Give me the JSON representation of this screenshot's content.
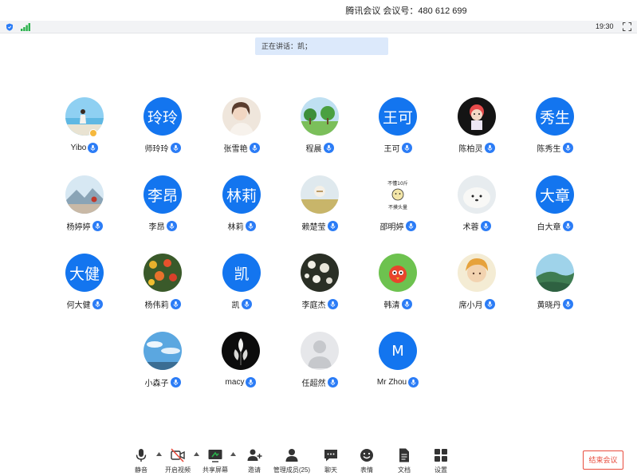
{
  "window": {
    "title": "腾讯会议  会议号：480 612 699"
  },
  "status": {
    "time": "19:30"
  },
  "speaker": {
    "label": "正在讲话：",
    "name": "凯；"
  },
  "participants": [
    {
      "name": "Yibo",
      "avatar_type": "photo",
      "avatar_theme": "beach",
      "initials": "",
      "host": true
    },
    {
      "name": "师玲玲",
      "avatar_type": "initials",
      "avatar_theme": "",
      "initials": "玲玲",
      "host": false
    },
    {
      "name": "张雪艳",
      "avatar_type": "photo",
      "avatar_theme": "portrait-girl",
      "initials": "",
      "host": false
    },
    {
      "name": "程晨",
      "avatar_type": "photo",
      "avatar_theme": "trees",
      "initials": "",
      "host": false
    },
    {
      "name": "王可",
      "avatar_type": "initials",
      "avatar_theme": "",
      "initials": "王可",
      "host": false
    },
    {
      "name": "陈柏灵",
      "avatar_type": "photo",
      "avatar_theme": "cartoon-girl",
      "initials": "",
      "host": false
    },
    {
      "name": "陈秀生",
      "avatar_type": "initials",
      "avatar_theme": "",
      "initials": "秀生",
      "host": false
    },
    {
      "name": "杨婷婷",
      "avatar_type": "photo",
      "avatar_theme": "mountain",
      "initials": "",
      "host": false
    },
    {
      "name": "李昂",
      "avatar_type": "initials",
      "avatar_theme": "",
      "initials": "李昂",
      "host": false
    },
    {
      "name": "林莉",
      "avatar_type": "initials",
      "avatar_theme": "",
      "initials": "林莉",
      "host": false
    },
    {
      "name": "赖楚莹",
      "avatar_type": "photo",
      "avatar_theme": "field",
      "initials": "",
      "host": false
    },
    {
      "name": "邵明婷",
      "avatar_type": "photo",
      "avatar_theme": "meme",
      "initials": "",
      "host": false,
      "avatar_text": [
        "不懂10斤",
        "不摸头量"
      ]
    },
    {
      "name": "术蓉",
      "avatar_type": "photo",
      "avatar_theme": "seal",
      "initials": "",
      "host": false
    },
    {
      "name": "白大章",
      "avatar_type": "initials",
      "avatar_theme": "",
      "initials": "大章",
      "host": false
    },
    {
      "name": "何大健",
      "avatar_type": "initials",
      "avatar_theme": "",
      "initials": "大健",
      "host": false
    },
    {
      "name": "杨伟莉",
      "avatar_type": "photo",
      "avatar_theme": "flowers",
      "initials": "",
      "host": false
    },
    {
      "name": "凯",
      "avatar_type": "initials",
      "avatar_theme": "",
      "initials": "凯",
      "host": false
    },
    {
      "name": "李庭杰",
      "avatar_type": "photo",
      "avatar_theme": "blossoms",
      "initials": "",
      "host": false
    },
    {
      "name": "韩清",
      "avatar_type": "photo",
      "avatar_theme": "cartoon-bird",
      "initials": "",
      "host": false
    },
    {
      "name": "席小月",
      "avatar_type": "photo",
      "avatar_theme": "anime",
      "initials": "",
      "host": false
    },
    {
      "name": "黄晓丹",
      "avatar_type": "photo",
      "avatar_theme": "hill",
      "initials": "",
      "host": false
    },
    {
      "name": "小森子",
      "avatar_type": "photo",
      "avatar_theme": "sky",
      "initials": "",
      "host": false
    },
    {
      "name": "macy",
      "avatar_type": "photo",
      "avatar_theme": "dark-flower",
      "initials": "",
      "host": false
    },
    {
      "name": "任超然",
      "avatar_type": "photo",
      "avatar_theme": "default-person",
      "initials": "",
      "host": false
    },
    {
      "name": "Mr Zhou",
      "avatar_type": "initials",
      "avatar_theme": "",
      "initials": "M",
      "host": false
    }
  ],
  "toolbar": {
    "mute": "静音",
    "video": "开启视频",
    "share": "共享屏幕",
    "invite": "邀请",
    "members": "管理成员(25)",
    "chat": "聊天",
    "reactions": "表情",
    "docs": "文档",
    "settings": "设置",
    "end": "结束会议"
  },
  "colors": {
    "accent": "#1375ef",
    "mic": "#2b7cf6",
    "end": "#e84c3d",
    "speaker_bg": "#dce9fb"
  }
}
